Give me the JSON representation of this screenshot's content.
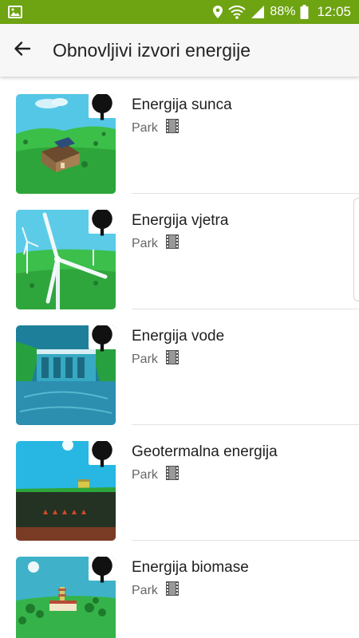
{
  "status_bar": {
    "battery_percent": "88%",
    "time": "12:05",
    "icons": [
      "image-icon",
      "location-icon",
      "wifi-icon",
      "signal-icon",
      "battery-icon"
    ]
  },
  "header": {
    "title": "Obnovljivi izvori energije",
    "back_icon": "arrow-left-icon"
  },
  "colors": {
    "status_bar": "#6ea312",
    "app_bar": "#f7f7f7"
  },
  "items": [
    {
      "title": "Energija sunca",
      "subtitle": "Park",
      "badge_icon": "tree-icon",
      "type_icon": "film-icon"
    },
    {
      "title": "Energija vjetra",
      "subtitle": "Park",
      "badge_icon": "tree-icon",
      "type_icon": "film-icon"
    },
    {
      "title": "Energija vode",
      "subtitle": "Park",
      "badge_icon": "tree-icon",
      "type_icon": "film-icon"
    },
    {
      "title": "Geotermalna energija",
      "subtitle": "Park",
      "badge_icon": "tree-icon",
      "type_icon": "film-icon"
    },
    {
      "title": "Energija biomase",
      "subtitle": "Park",
      "badge_icon": "tree-icon",
      "type_icon": "film-icon"
    }
  ]
}
